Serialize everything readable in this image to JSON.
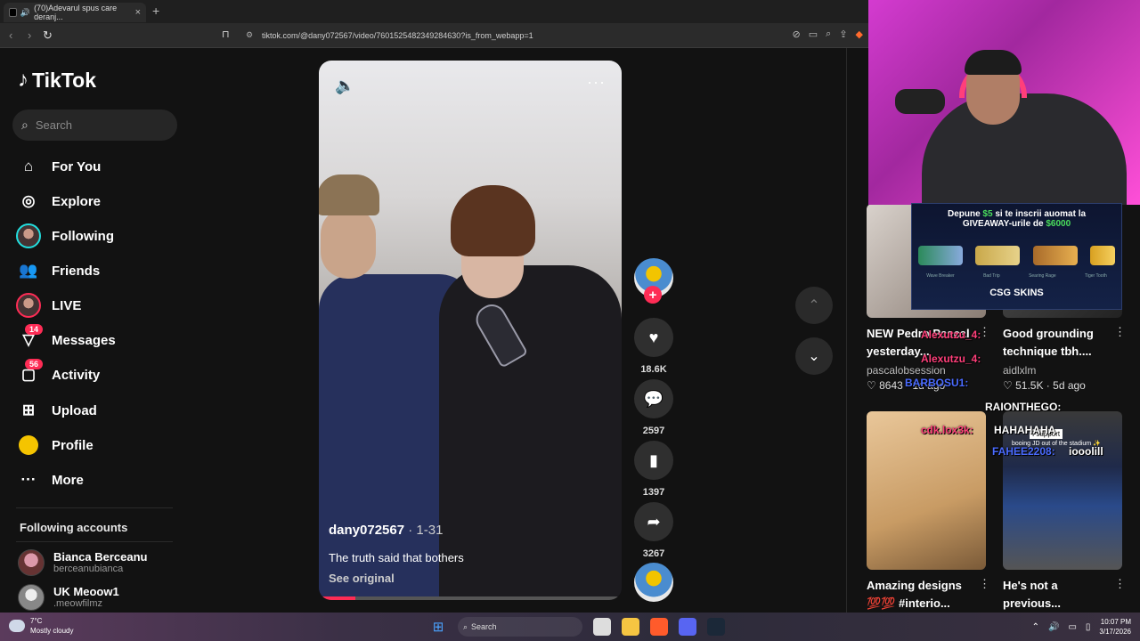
{
  "browser": {
    "tab_title": "(70)Adevarul spus care deranj...",
    "tab_close": "×",
    "new_tab": "+",
    "url": "tiktok.com/@dany072567/video/7601525482349284630?is_from_webapp=1"
  },
  "sidebar": {
    "logo": "TikTok",
    "search_placeholder": "Search",
    "nav": [
      {
        "label": "For You",
        "icon": "home-icon"
      },
      {
        "label": "Explore",
        "icon": "compass-icon"
      },
      {
        "label": "Following",
        "icon": "following-avatar"
      },
      {
        "label": "Friends",
        "icon": "friends-icon"
      },
      {
        "label": "LIVE",
        "icon": "live-avatar"
      },
      {
        "label": "Messages",
        "icon": "messages-icon",
        "badge": "14"
      },
      {
        "label": "Activity",
        "icon": "activity-icon",
        "badge": "56"
      },
      {
        "label": "Upload",
        "icon": "upload-icon"
      },
      {
        "label": "Profile",
        "icon": "profile-icon"
      },
      {
        "label": "More",
        "icon": "more-icon"
      }
    ],
    "following_title": "Following accounts",
    "accounts": [
      {
        "name": "Bianca Berceanu",
        "handle": "berceanubianca"
      },
      {
        "name": "UK Meoow1",
        "handle": ".meowfilmz"
      }
    ]
  },
  "video": {
    "author": "dany072567",
    "date": " · 1-31",
    "caption": "The truth said that bothers",
    "see_original": "See original",
    "progress": 0.12
  },
  "actions": {
    "likes": "18.6K",
    "comments": "2597",
    "saves": "1397",
    "shares": "3267"
  },
  "promo": {
    "line1_pre": "Depune ",
    "line1_amount": "$5",
    "line1_post": " si te inscrii auomat la",
    "line2_pre": "GIVEAWAY-urile de ",
    "line2_amount": "$6000",
    "skins": [
      "Wave Breaker",
      "Bad Trip",
      "Searing Rage",
      "Tiger Tooth"
    ],
    "brand": "CSG SKINS"
  },
  "recommendations": [
    {
      "title": "NEW Pedro Pascal yesterday...",
      "author": "pascalobsession",
      "likes": "8643",
      "age": "1d ago"
    },
    {
      "title": "Good grounding technique tbh....",
      "author": "aidlxlm",
      "likes": "51.5K",
      "age": "5d ago"
    },
    {
      "title": "Amazing designs 💯💯 #interio...",
      "author": "",
      "likes": "",
      "age": ""
    },
    {
      "title": "He's not a previous...",
      "author": "",
      "likes": "",
      "age": ""
    }
  ],
  "chat": [
    {
      "user": "Alexutzu_4:",
      "color": "#ff3f7a"
    },
    {
      "user": "Alexutzu_4:",
      "color": "#ff3f7a"
    },
    {
      "user": "BARBOSU1:",
      "color": "#4a6bff"
    },
    {
      "user": "RAIONTHEGO:",
      "color": "#ffffff"
    },
    {
      "user": "cdk.lox3k:",
      "color": "#ff3f7a"
    },
    {
      "user": "HAHAHAHA",
      "color": "#ffffff"
    },
    {
      "user": "FAHEE2208:",
      "color": "#4a6bff"
    },
    {
      "user": "iooolill",
      "color": "#ffffff"
    }
  ],
  "tweet_overlay": {
    "line1": "I support",
    "line2": "booing JD out of the stadium ✨"
  },
  "taskbar": {
    "temp": "7°C",
    "weather": "Mostly cloudy",
    "search": "Search",
    "time": "10:07 PM",
    "date": "3/17/2026"
  },
  "colors": {
    "accent": "#fe2c55",
    "page_bg": "#121212",
    "webcam_bg": "#d43bd0"
  }
}
